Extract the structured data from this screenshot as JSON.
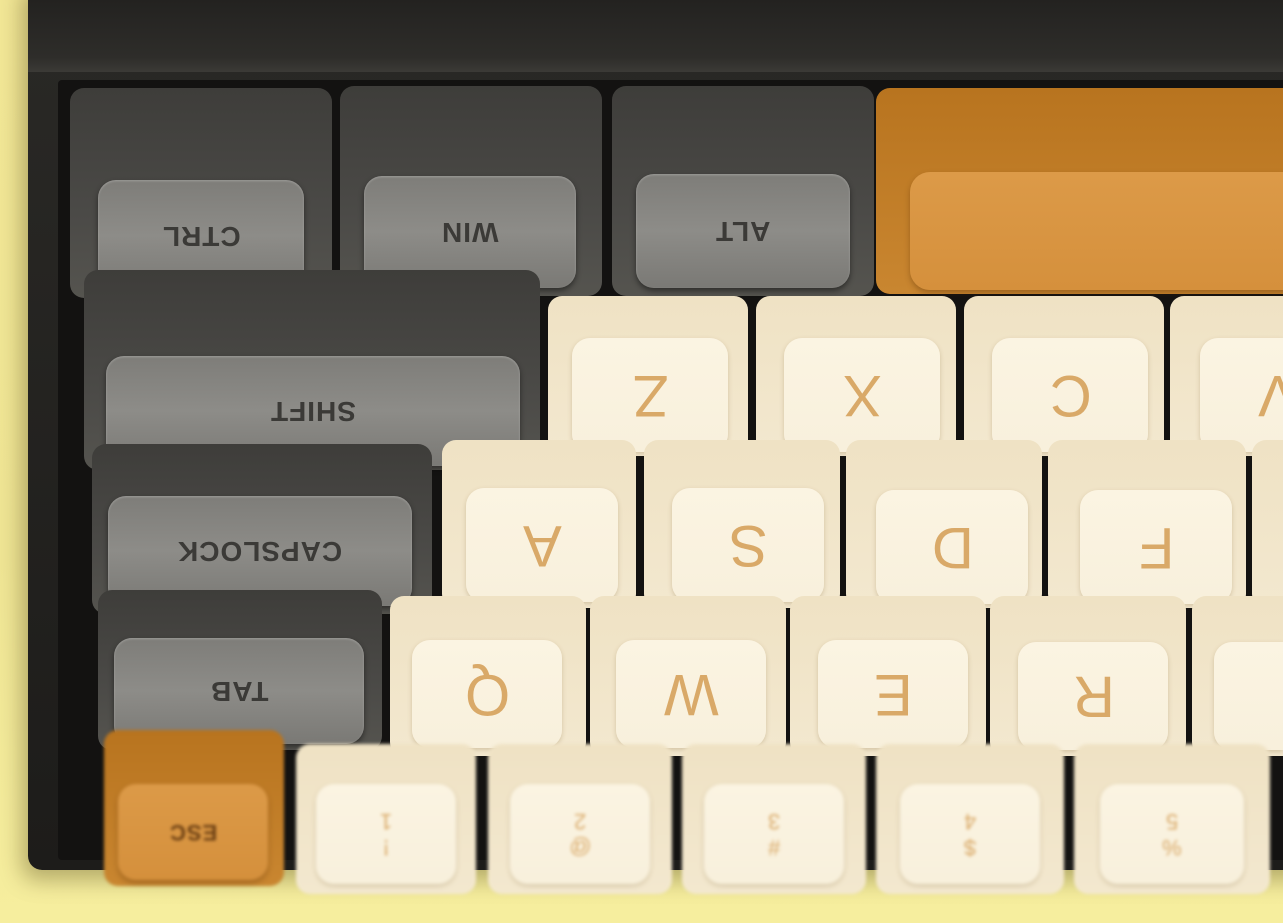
{
  "keyboard": {
    "mods": {
      "ctrl": "CTRL",
      "win": "WIN",
      "alt": "ALT",
      "shift": "SHIFT",
      "capslock": "CAPSLOCK",
      "tab": "TAB",
      "esc": "ESC"
    },
    "row_zx": [
      "Z",
      "X",
      "C",
      "V"
    ],
    "row_as": [
      "A",
      "S",
      "D",
      "F"
    ],
    "row_qw": [
      "Q",
      "W",
      "E",
      "R"
    ],
    "row_num": [
      {
        "main": "1",
        "shift": "!"
      },
      {
        "main": "2",
        "shift": "@"
      },
      {
        "main": "3",
        "shift": "#"
      },
      {
        "main": "4",
        "shift": "$"
      },
      {
        "main": "5",
        "shift": "%"
      }
    ],
    "colors": {
      "case": "#1d1c1a",
      "mod_key": "#8d8c88",
      "alpha_key": "#f8f0dc",
      "legend": "#d9a968",
      "accent_orange": "#d5903c",
      "background": "#efe594"
    }
  }
}
